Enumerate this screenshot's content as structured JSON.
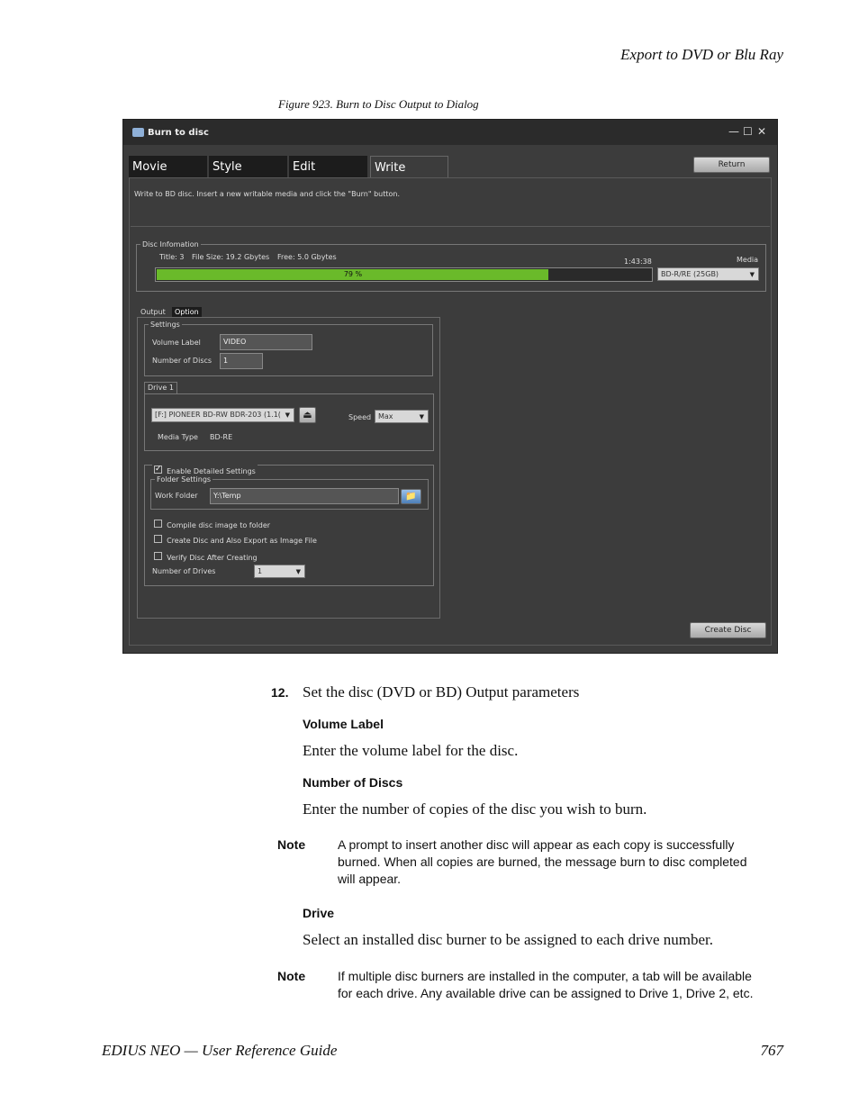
{
  "header": {
    "running_title": "Export to DVD or Blu Ray"
  },
  "figure": {
    "caption": "Figure 923.  Burn to Disc Output to Dialog"
  },
  "dialog": {
    "title": "Burn to disc",
    "window_controls": [
      "minimize-icon",
      "maximize-icon",
      "close-icon"
    ],
    "tabs": [
      "Movie",
      "Style",
      "Edit",
      "Write"
    ],
    "active_tab": "Write",
    "return_button": "Return",
    "instruction": "Write to BD disc. Insert a new writable media and click the \"Burn\" button.",
    "disc_info": {
      "legend": "Disc Infomation",
      "title_info": "Title: 3",
      "file_size": "File Size: 19.2 Gbytes",
      "free": "Free: 5.0 Gbytes",
      "time": "1:43:38",
      "media_label": "Media",
      "media_value": "BD-R/RE (25GB)",
      "progress_percent": 79,
      "progress_text": "79 %",
      "progress_accent": "#6aba2a"
    },
    "output_tabs": [
      "Output",
      "Option"
    ],
    "settings": {
      "legend": "Settings",
      "volume_label_label": "Volume Label",
      "volume_label_value": "VIDEO",
      "number_of_discs_label": "Number of Discs",
      "number_of_discs_value": "1"
    },
    "drive": {
      "tab": "Drive 1",
      "drive_value": "[F:] PIONEER BD-RW   BDR-203 (1.1(",
      "speed_label": "Speed",
      "speed_value": "Max",
      "media_type_label": "Media Type",
      "media_type_value": "BD-RE"
    },
    "detailed": {
      "enable_label": "Enable Detailed Settings",
      "enable_checked": true,
      "folder_legend": "Folder Settings",
      "work_folder_label": "Work Folder",
      "work_folder_value": "Y:\\Temp",
      "compile_label": "Compile disc image to folder",
      "create_export_label": "Create Disc and Also Export as Image File",
      "verify_label": "Verify Disc After Creating",
      "number_of_drives_label": "Number of Drives",
      "number_of_drives_value": "1"
    },
    "create_button": "Create Disc"
  },
  "content": {
    "step_number": "12.",
    "step_text": "Set the disc (DVD or BD) Output parameters",
    "volume_label_heading": "Volume Label",
    "volume_label_text": "Enter the volume label for the disc.",
    "number_of_discs_heading": "Number of Discs",
    "number_of_discs_text": "Enter the number of copies of the disc you wish to burn.",
    "note1_label": "Note",
    "note1_text": "A prompt to insert another disc will appear as each copy is successfully burned. When all copies are burned, the message burn to disc completed will appear.",
    "drive_heading": "Drive",
    "drive_text": "Select an installed disc burner to be assigned to each drive number.",
    "note2_label": "Note",
    "note2_text": "If multiple disc burners are installed in the computer, a tab will be available for each drive. Any available drive can be assigned to Drive 1, Drive 2, etc."
  },
  "footer": {
    "left": "EDIUS NEO  —  User Reference Guide",
    "page_number": "767"
  }
}
